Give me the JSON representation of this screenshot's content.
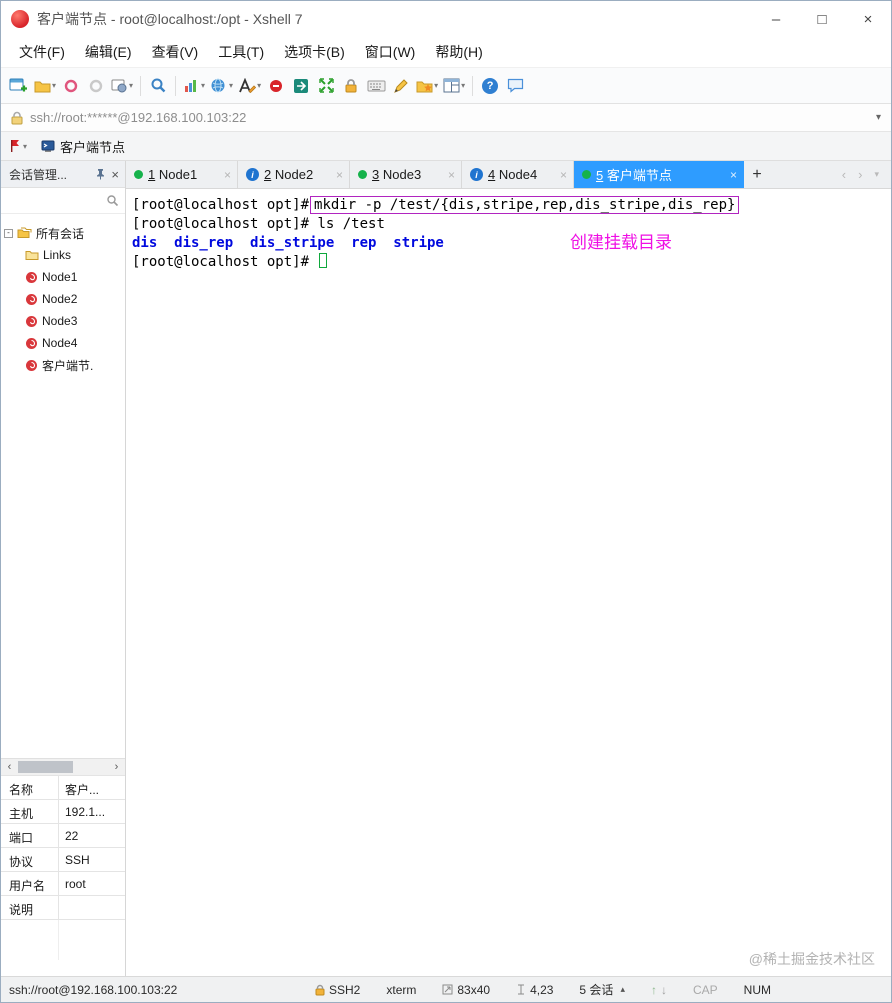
{
  "window": {
    "title": "客户端节点 - root@localhost:/opt - Xshell 7"
  },
  "icons": {
    "minimize": "–",
    "maximize": "□",
    "close": "×",
    "dropdown": "▾",
    "back": "‹",
    "forward": "›",
    "plus": "+",
    "up_caret": "▴",
    "expander": "-",
    "info": "i",
    "help": "?",
    "arrow_up": "↑",
    "arrow_down": "↓"
  },
  "menu": {
    "items": [
      "文件(F)",
      "编辑(E)",
      "查看(V)",
      "工具(T)",
      "选项卡(B)",
      "窗口(W)",
      "帮助(H)"
    ]
  },
  "address_bar": {
    "value": "ssh://root:******@192.168.100.103:22"
  },
  "quick_bar": {
    "session_label": "客户端节点"
  },
  "session_panel": {
    "title": "会话管理...",
    "tree_root": "所有会话",
    "items": [
      {
        "label": "Links",
        "icon": "folder"
      },
      {
        "label": "Node1",
        "icon": "session"
      },
      {
        "label": "Node2",
        "icon": "session"
      },
      {
        "label": "Node3",
        "icon": "session"
      },
      {
        "label": "Node4",
        "icon": "session"
      },
      {
        "label": "客户端节.",
        "icon": "session"
      }
    ]
  },
  "tabs": [
    {
      "num": "1",
      "label": "Node1",
      "status": "connected"
    },
    {
      "num": "2",
      "label": "Node2",
      "status": "info"
    },
    {
      "num": "3",
      "label": "Node3",
      "status": "connected"
    },
    {
      "num": "4",
      "label": "Node4",
      "status": "info"
    },
    {
      "num": "5",
      "label": "客户端节点",
      "status": "connected",
      "active": true
    }
  ],
  "terminal": {
    "l1_prompt": "[root@localhost opt]#",
    "l1_command": "mkdir -p /test/{dis,stripe,rep,dis_stripe,dis_rep}",
    "l2_prompt": "[root@localhost opt]# ",
    "l2_command": "ls /test",
    "l3_output": "dis  dis_rep  dis_stripe  rep  stripe",
    "l4_prompt": "[root@localhost opt]# ",
    "annotation": "创建挂载目录"
  },
  "properties": {
    "rows": [
      {
        "label": "名称",
        "value": "客户..."
      },
      {
        "label": "主机",
        "value": "192.1..."
      },
      {
        "label": "端口",
        "value": "22"
      },
      {
        "label": "协议",
        "value": "SSH"
      },
      {
        "label": "用户名",
        "value": "root"
      },
      {
        "label": "说明",
        "value": ""
      }
    ]
  },
  "status_bar": {
    "url": "ssh://root@192.168.100.103:22",
    "protocol": "SSH2",
    "terminal_type": "xterm",
    "size": "83x40",
    "cursor_pos": "4,23",
    "sessions": "5 会话",
    "caps": "CAP",
    "num": "NUM"
  },
  "watermark": "@稀土掘金技术社区"
}
